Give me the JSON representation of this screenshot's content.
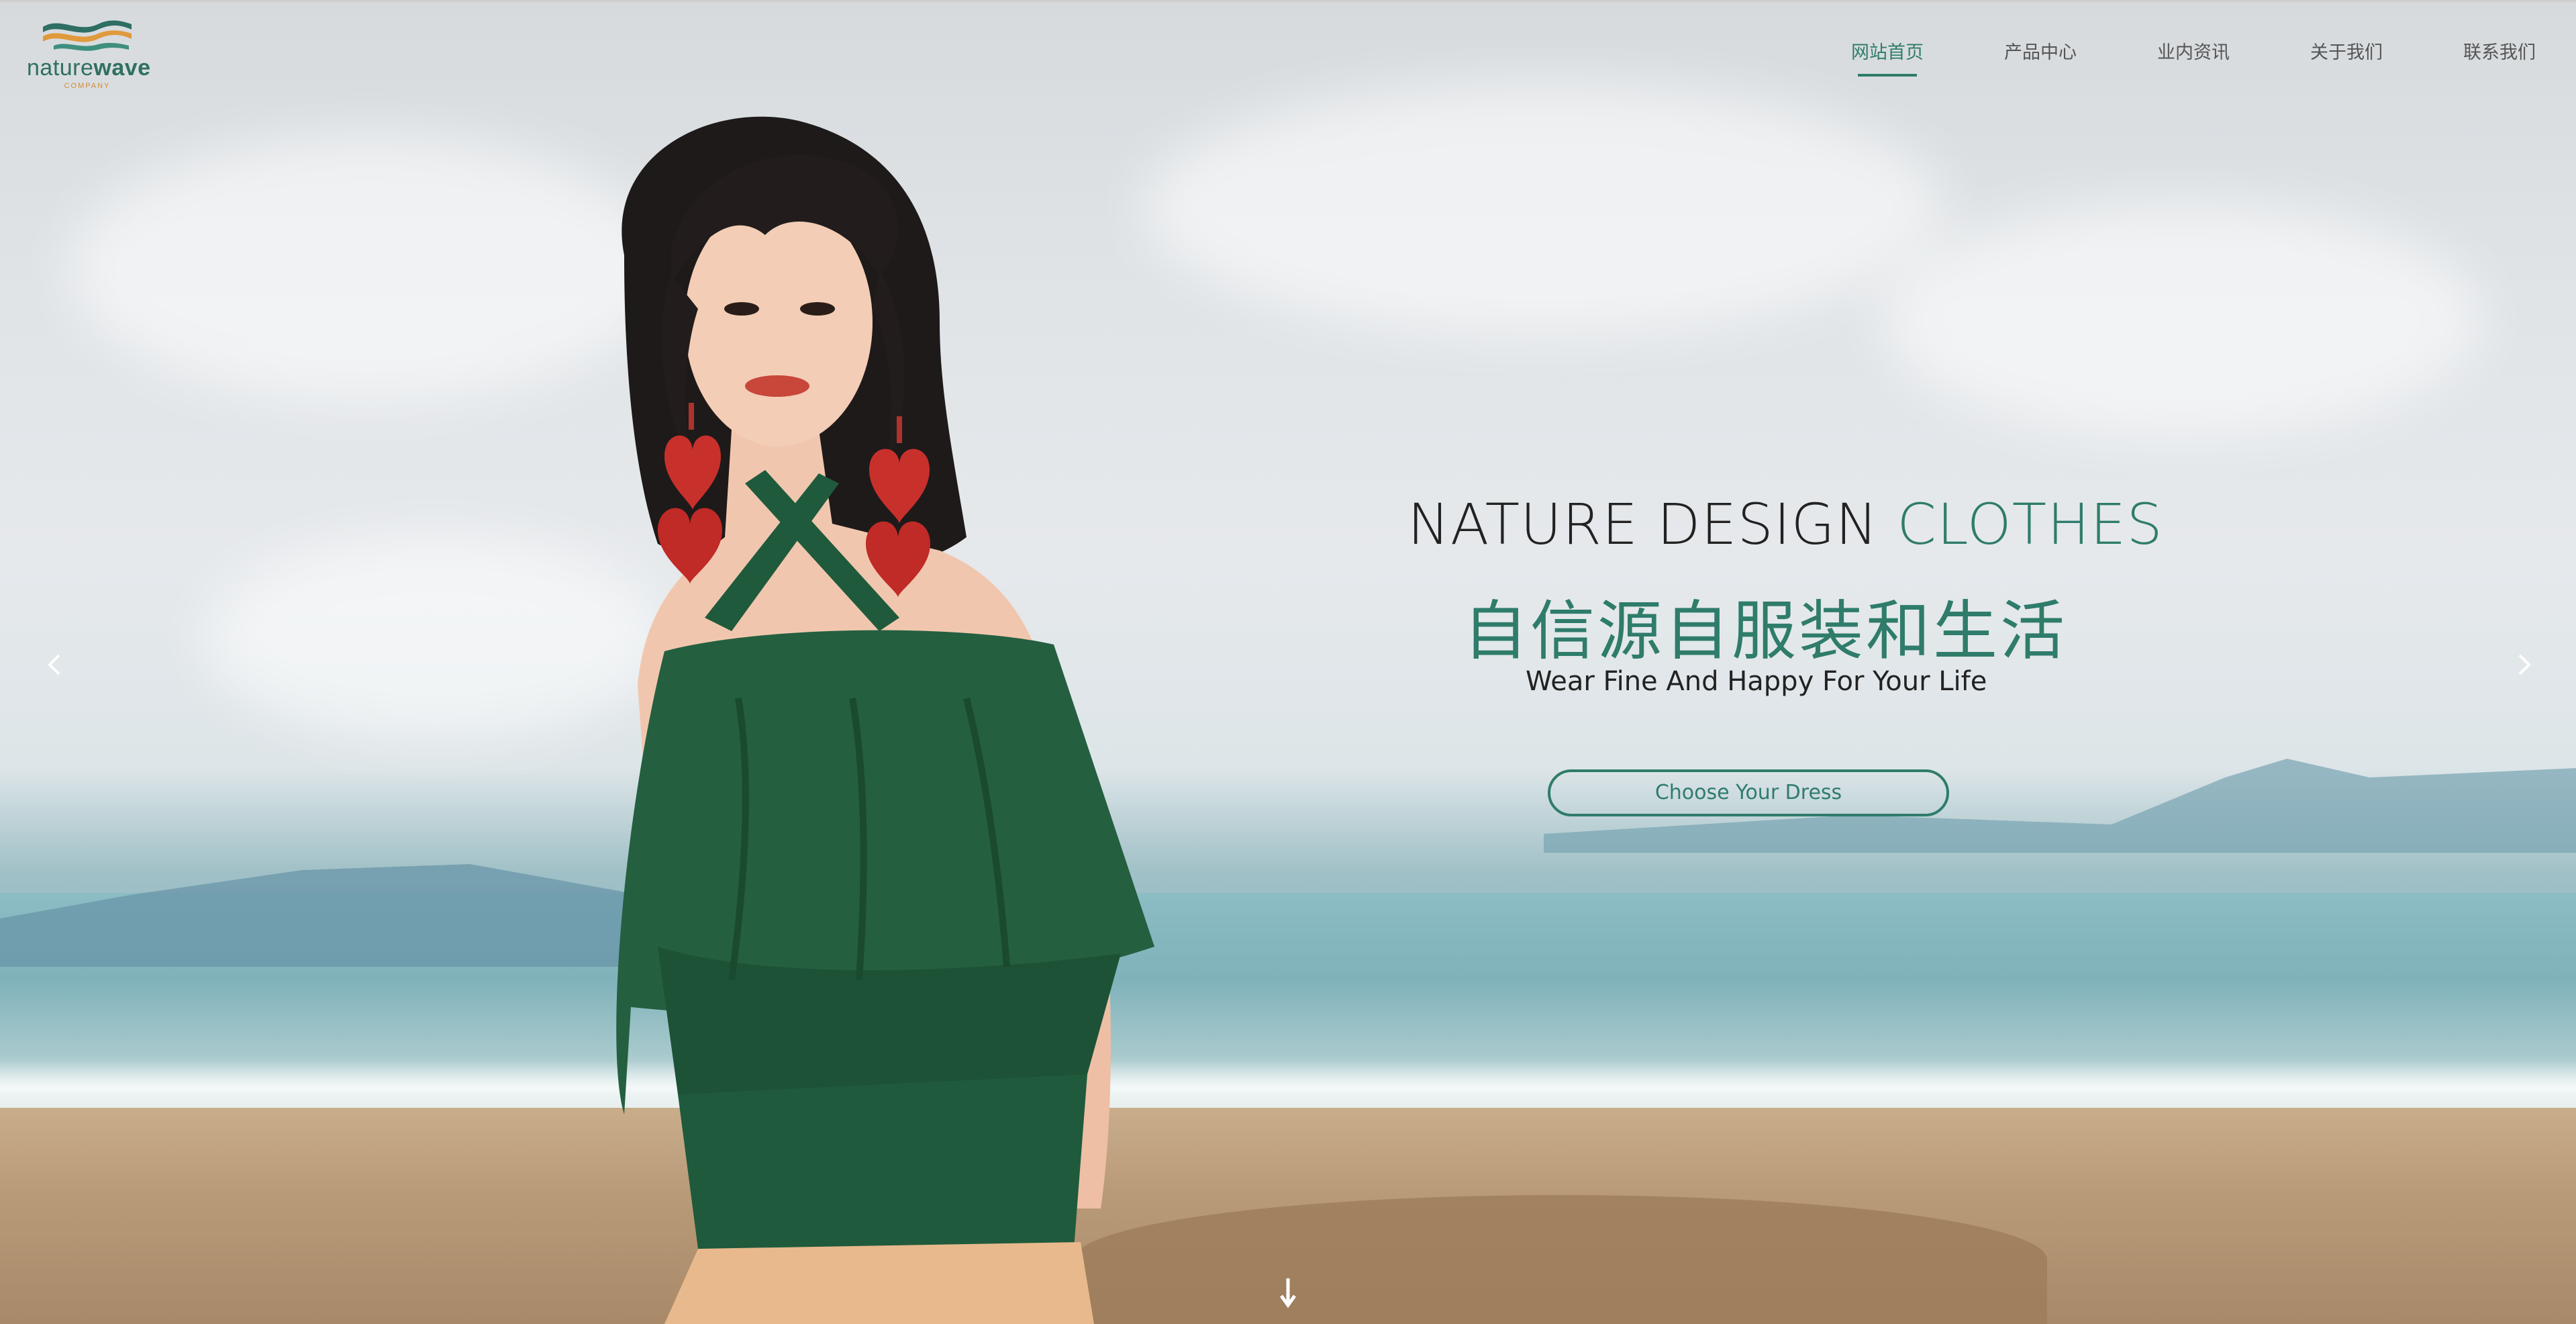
{
  "brand": {
    "name_light": "nature",
    "name_bold": "wave",
    "tagline": "COMPANY"
  },
  "nav": {
    "items": [
      {
        "label": "网站首页",
        "active": true
      },
      {
        "label": "产品中心",
        "active": false
      },
      {
        "label": "业内资讯",
        "active": false
      },
      {
        "label": "关于我们",
        "active": false
      },
      {
        "label": "联系我们",
        "active": false
      }
    ]
  },
  "hero": {
    "headline_dark": "NATURE DESIGN ",
    "headline_green": "CLOTHES",
    "subtitle_cn": "自信源自服装和生活",
    "subtitle_en": "Wear Fine And Happy For Your Life",
    "cta_label": "Choose Your Dress"
  },
  "carousel": {
    "prev_icon": "chevron-left-icon",
    "next_icon": "chevron-right-icon",
    "scroll_icon": "arrow-down-icon"
  },
  "colors": {
    "accent": "#2f7c6b",
    "logo_orange": "#d28b2f",
    "text_dark": "#222222"
  }
}
